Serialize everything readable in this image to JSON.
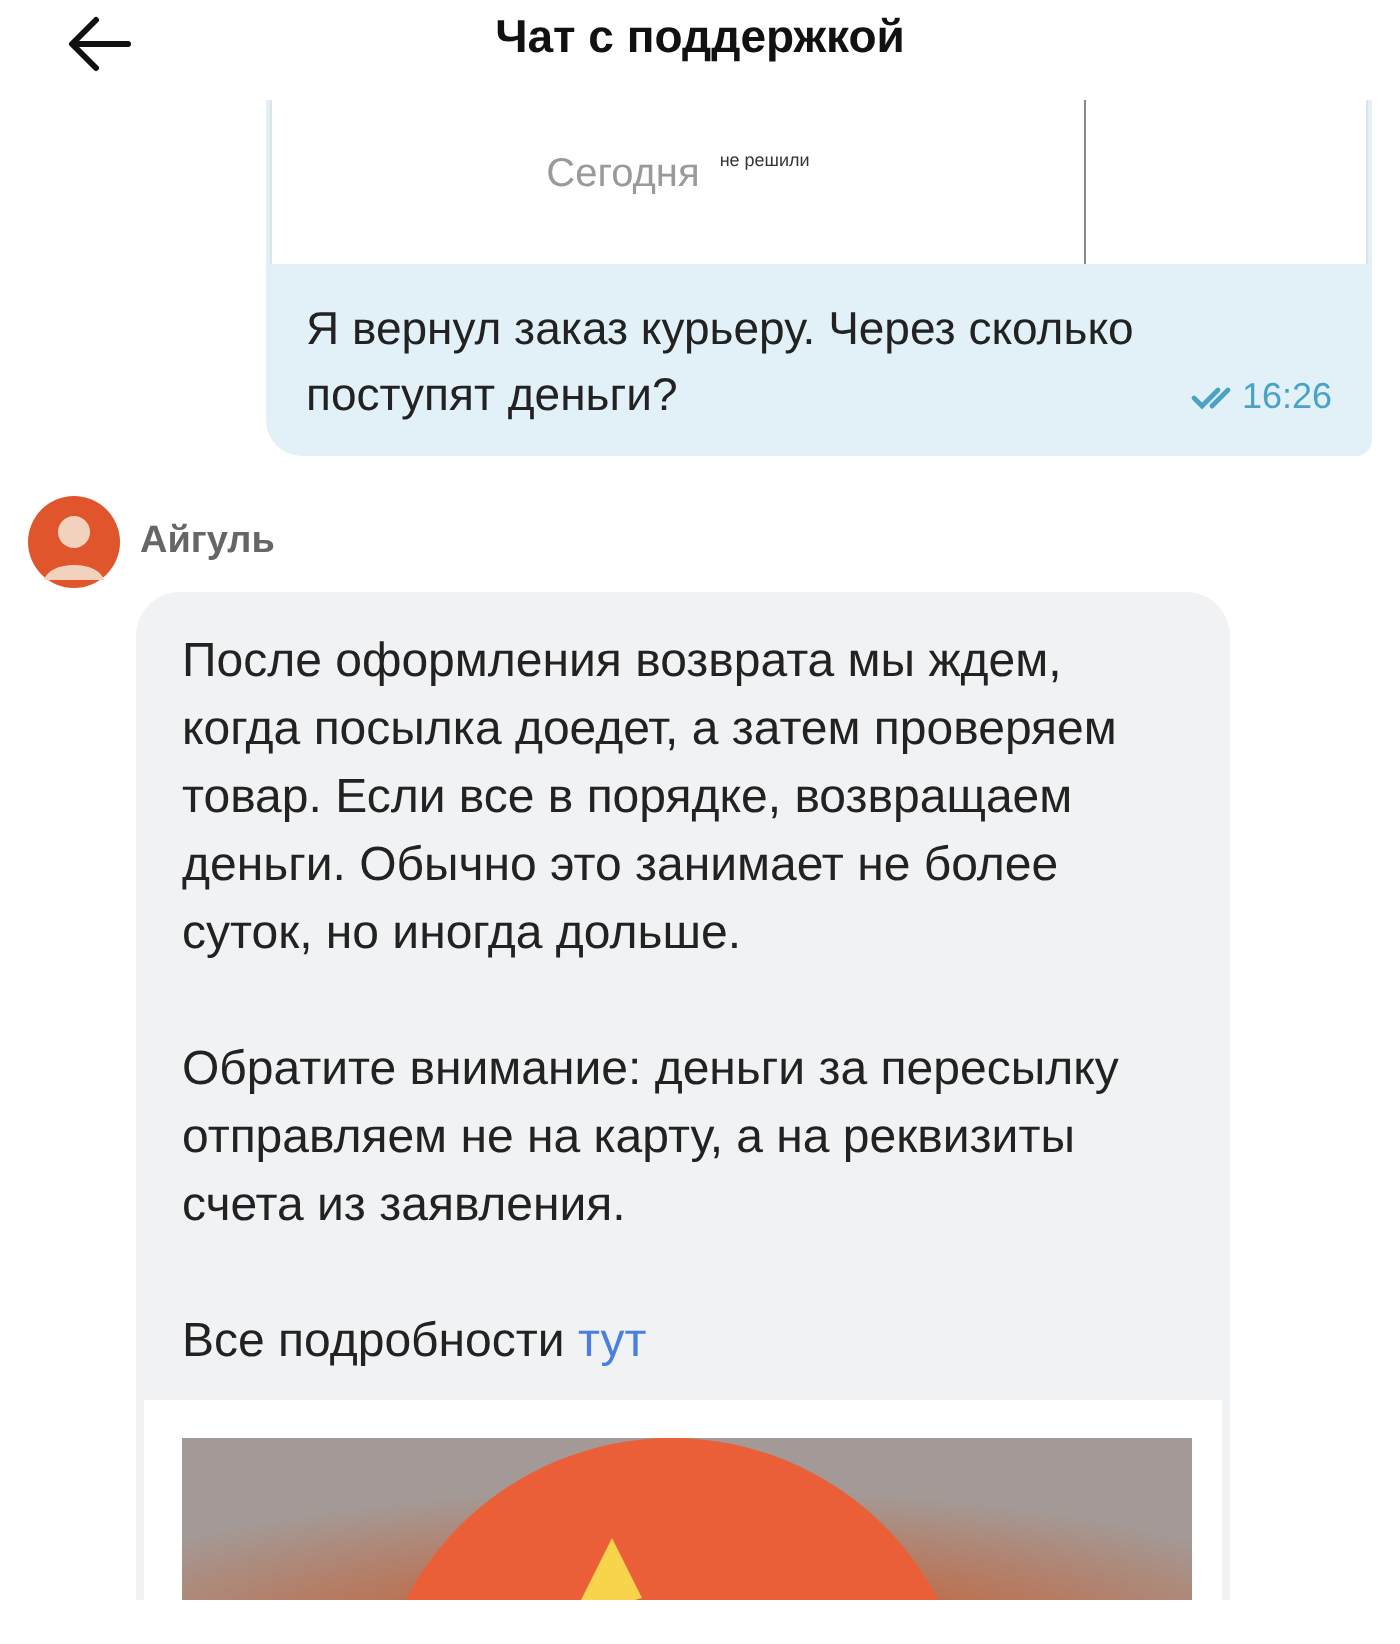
{
  "header": {
    "title": "Чат с поддержкой"
  },
  "messages": [
    {
      "kind": "outgoing",
      "attachment": {
        "label": "Сегодня",
        "note": "не решили"
      },
      "text": "Я вернул заказ курьеру. Через сколько поступят деньги?",
      "time": "16:26",
      "read": true
    },
    {
      "kind": "incoming",
      "author": "Айгуль",
      "paragraphs": [
        "После оформления возврата мы ждем, когда посылка доедет, а затем проверяем товар. Если все в порядке, возвращаем деньги. Обычно это занимает не более суток, но иногда дольше.",
        "Обратите внимание: деньги за пересылку отправляем не на карту, а на реквизиты счета из заявления."
      ],
      "footer": {
        "text": "Все подробности",
        "link": "тут"
      }
    }
  ]
}
